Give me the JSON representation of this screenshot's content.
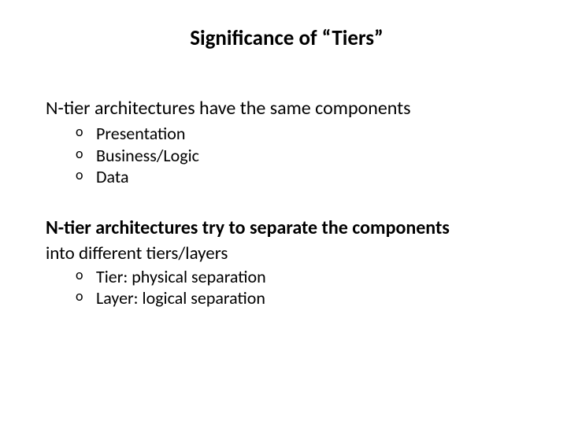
{
  "title": "Significance of “Tiers”",
  "section1": {
    "heading": "N-tier architectures have the same components",
    "items": [
      "Presentation",
      "Business/Logic",
      "Data"
    ]
  },
  "section2": {
    "heading_bold": "N-tier architectures try to separate the components",
    "subline": "into different tiers/layers",
    "items": [
      "Tier: physical separation",
      "Layer: logical separation"
    ]
  }
}
